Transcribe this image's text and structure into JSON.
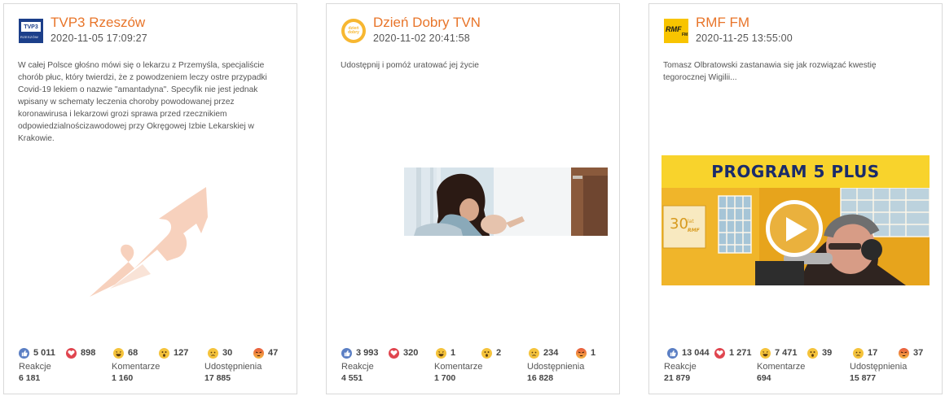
{
  "cards": [
    {
      "source": "TVP3 Rzeszów",
      "date": "2020-11-05 17:09:27",
      "logo_text": "TVP3",
      "logo_sub": "RZESZÓW",
      "text": "W całej Polsce głośno mówi się o lekarzu z Przemyśla, specjaliście chorób płuc, który twierdzi, że z powodzeniem leczy ostre przypadki Covid-19 lekiem o nazwie \"amantadyna\". Specyfik nie jest jednak wpisany w schematy leczenia choroby powodowanej przez koronawirusa i lekarzowi grozi sprawa przed rzecznikiem odpowiedzialnościzawodowej przy Okręgowej Izbie Lekarskiej w Krakowie.",
      "reactions": {
        "like": "5 011",
        "love": "898",
        "haha": "68",
        "wow": "127",
        "sad": "30",
        "angry": "47"
      },
      "stats": {
        "reakcje_label": "Reakcje",
        "reakcje": "6 181",
        "komentarze_label": "Komentarze",
        "komentarze": "1 160",
        "udostepnienia_label": "Udostępnienia",
        "udostepnienia": "17 885"
      }
    },
    {
      "source": "Dzień Dobry TVN",
      "date": "2020-11-02 20:41:58",
      "logo_text": "dzień dobry",
      "text": "Udostępnij i pomóż uratować jej życie",
      "reactions": {
        "like": "3 993",
        "love": "320",
        "haha": "1",
        "wow": "2",
        "sad": "234",
        "angry": "1"
      },
      "stats": {
        "reakcje_label": "Reakcje",
        "reakcje": "4 551",
        "komentarze_label": "Komentarze",
        "komentarze": "1 700",
        "udostepnienia_label": "Udostępnienia",
        "udostepnienia": "16 828"
      }
    },
    {
      "source": "RMF FM",
      "date": "2020-11-25 13:55:00",
      "logo_text": "RMF",
      "logo_sub": "FM",
      "text": "Tomasz Olbratowski zastanawia się jak rozwiązać kwestię tegorocznej Wigilii...",
      "banner": "PROGRAM 5 PLUS",
      "badge": "30",
      "badge_sub": "lat",
      "badge_brand": "RMF",
      "reactions": {
        "like": "13 044",
        "love": "1 271",
        "haha": "7 471",
        "wow": "39",
        "sad": "17",
        "angry": "37"
      },
      "stats": {
        "reakcje_label": "Reakcje",
        "reakcje": "21 879",
        "komentarze_label": "Komentarze",
        "komentarze": "694",
        "udostepnienia_label": "Udostępnienia",
        "udostepnienia": "15 877"
      }
    }
  ],
  "colors": {
    "accent": "#e8752a",
    "like": "#5b7fc4",
    "love": "#e0454f",
    "emoji": "#f5c33b",
    "angry": "#e8593c"
  },
  "icons": [
    "like-icon",
    "love-icon",
    "haha-icon",
    "wow-icon",
    "sad-icon",
    "angry-icon",
    "play-icon"
  ]
}
